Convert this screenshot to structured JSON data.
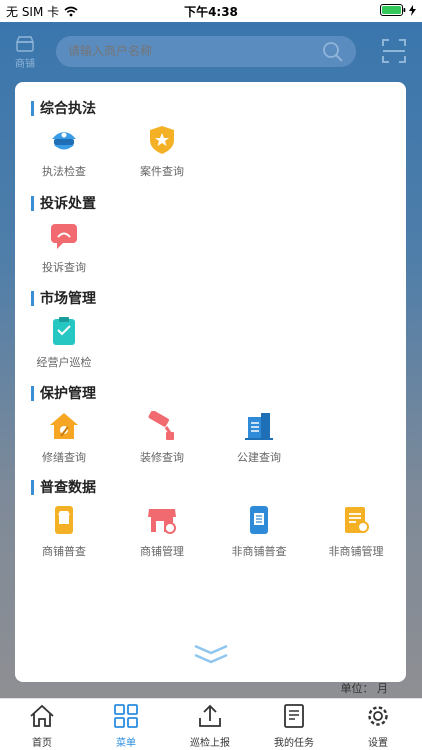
{
  "status_bar": {
    "carrier": "无 SIM 卡",
    "time": "下午4:38"
  },
  "header": {
    "store_label": "商铺",
    "search_placeholder": "请输入商户名称"
  },
  "sections": [
    {
      "title": "综合执法",
      "items": [
        {
          "label": "执法检查",
          "icon": "police-cap-icon"
        },
        {
          "label": "案件查询",
          "icon": "badge-star-icon"
        }
      ]
    },
    {
      "title": "投诉处置",
      "items": [
        {
          "label": "投诉查询",
          "icon": "complaint-bubble-icon"
        }
      ]
    },
    {
      "title": "市场管理",
      "items": [
        {
          "label": "经营户巡检",
          "icon": "inspection-clipboard-icon"
        }
      ]
    },
    {
      "title": "保护管理",
      "items": [
        {
          "label": "修缮查询",
          "icon": "house-repair-icon"
        },
        {
          "label": "装修查询",
          "icon": "paint-roller-icon"
        },
        {
          "label": "公建查询",
          "icon": "public-building-icon"
        }
      ]
    },
    {
      "title": "普查数据",
      "items": [
        {
          "label": "商铺普查",
          "icon": "shop-phone-icon"
        },
        {
          "label": "商铺管理",
          "icon": "storefront-icon"
        },
        {
          "label": "非商铺普查",
          "icon": "phone-list-icon"
        },
        {
          "label": "非商铺管理",
          "icon": "document-search-icon"
        }
      ]
    }
  ],
  "unit_label": "单位：  月",
  "tabbar": [
    {
      "label": "首页",
      "icon": "home-icon"
    },
    {
      "label": "菜单",
      "icon": "grid-menu-icon",
      "active": true
    },
    {
      "label": "巡检上报",
      "icon": "upload-icon"
    },
    {
      "label": "我的任务",
      "icon": "task-list-icon"
    },
    {
      "label": "设置",
      "icon": "settings-gear-icon"
    }
  ],
  "colors": {
    "accent": "#2a8de0",
    "header_bg": "#3a76ad",
    "section_bar": "#3a8fd4"
  }
}
